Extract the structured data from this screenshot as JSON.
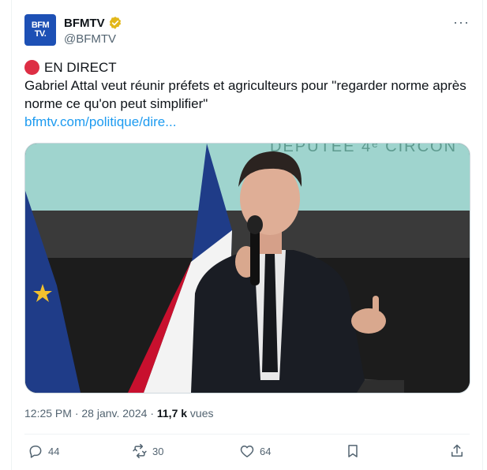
{
  "author": {
    "avatar_line1": "BFM",
    "avatar_line2": "TV.",
    "name": "BFMTV",
    "handle": "@BFMTV"
  },
  "tweet": {
    "live_label": "EN DIRECT",
    "text": "Gabriel Attal veut réunir préfets et agriculteurs pour \"regarder norme après norme ce qu'on peut simplifier\"",
    "link": "bfmtv.com/politique/dire..."
  },
  "media": {
    "backdrop_text": "DÉPUTÉE 4ᵉ CIRCON"
  },
  "meta": {
    "time": "12:25 PM",
    "date": "28 janv. 2024",
    "views_count": "11,7 k",
    "views_label": "vues"
  },
  "actions": {
    "replies": "44",
    "reposts": "30",
    "likes": "64"
  },
  "colors": {
    "link": "#1d9bf0",
    "live": "#dd2e44",
    "secondary_text": "#536471",
    "verified": "#e2b719"
  }
}
